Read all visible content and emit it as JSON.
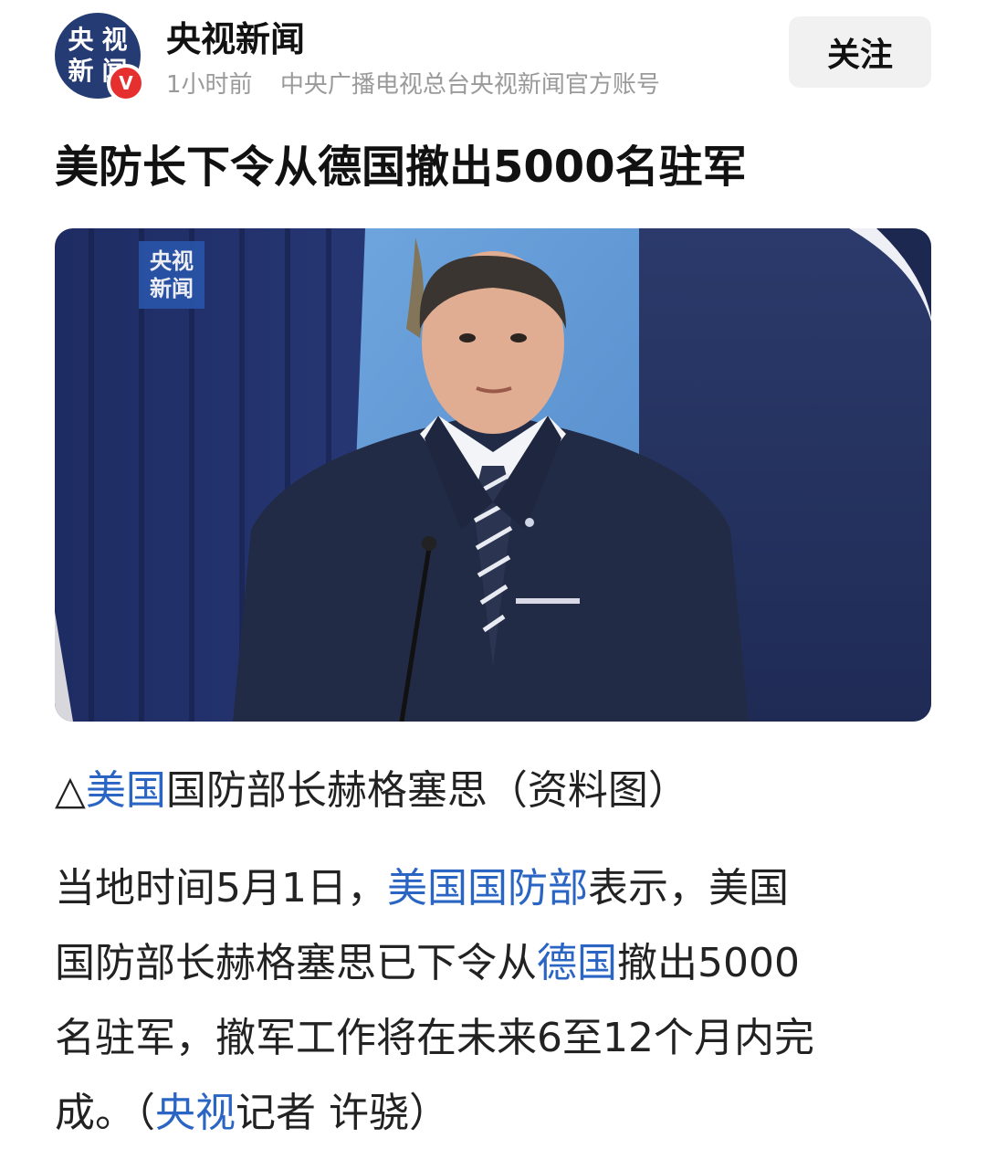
{
  "header": {
    "avatar_text": [
      "央",
      "视",
      "新",
      "闻"
    ],
    "verified_mark": "V",
    "author_name": "央视新闻",
    "time": "1小时前",
    "source": "中央广播电视总台央视新闻官方账号",
    "follow_label": "关注"
  },
  "article": {
    "title": "美防长下令从德国撤出5000名驻军",
    "photo_watermark": [
      "央视",
      "新闻"
    ],
    "caption": {
      "prefix": "△",
      "link": "美国",
      "rest": "国防部长赫格塞思（资料图）"
    },
    "body": {
      "p1": "当地时间5月1日，",
      "link1": "美国国防部",
      "p2": "表示，美国",
      "p3": "国防部长赫格塞思已下令从",
      "link2": "德国",
      "p4": "撤出5000",
      "p5": "名驻军，撤军工作将在未来6至12个月内完",
      "p6": "成。（",
      "link3": "央视",
      "p7": "记者 许骁）"
    }
  },
  "colors": {
    "link": "#2a65c4",
    "avatar_bg": "#243b73",
    "verified": "#e5302f",
    "follow_bg": "#f1f1f1",
    "meta_gray": "#9a9a9a"
  }
}
